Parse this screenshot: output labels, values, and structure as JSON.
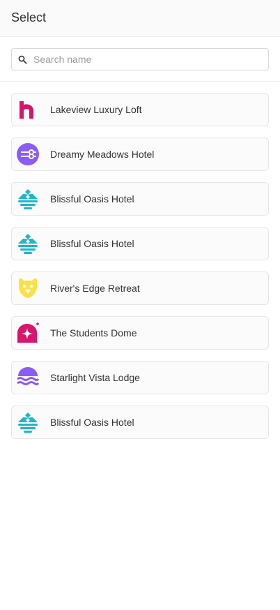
{
  "header": {
    "title": "Select"
  },
  "search": {
    "placeholder": "Search name",
    "value": "",
    "icon": "search-icon"
  },
  "colors": {
    "magenta": "#d6166d",
    "purple": "#8b5cf6",
    "teal": "#1fb6c9",
    "yellow": "#fde047"
  },
  "items": [
    {
      "label": "Lakeview Luxury Loft",
      "icon": "house-logo-icon"
    },
    {
      "label": "Dreamy Meadows Hotel",
      "icon": "connector-logo-icon"
    },
    {
      "label": "Blissful Oasis Hotel",
      "icon": "mountain-lake-logo-icon"
    },
    {
      "label": "Blissful Oasis Hotel",
      "icon": "mountain-lake-logo-icon"
    },
    {
      "label": "River's Edge Retreat",
      "icon": "bear-logo-icon"
    },
    {
      "label": "The Students Dome",
      "icon": "sparkle-dome-logo-icon"
    },
    {
      "label": "Starlight Vista Lodge",
      "icon": "waves-logo-icon"
    },
    {
      "label": "Blissful Oasis Hotel",
      "icon": "mountain-lake-logo-icon"
    }
  ]
}
